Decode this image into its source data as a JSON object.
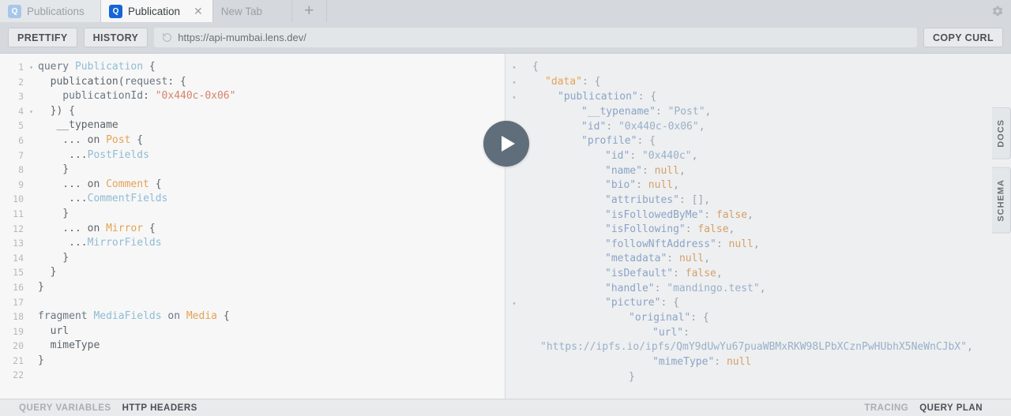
{
  "tabs": [
    {
      "badge": "Q",
      "label": "Publications",
      "active": false,
      "closable": false
    },
    {
      "badge": "Q",
      "label": "Publication",
      "active": true,
      "closable": true
    },
    {
      "badge": "",
      "label": "New Tab",
      "active": false,
      "closable": false
    }
  ],
  "tab_add_label": "+",
  "gear_icon": "gear-icon",
  "toolbar": {
    "prettify_label": "PRETTIFY",
    "history_label": "HISTORY",
    "url_value": "https://api-mumbai.lens.dev/",
    "url_icon": "history-revert-icon",
    "copy_curl_label": "COPY CURL"
  },
  "editor": {
    "lines": [
      {
        "n": "1",
        "fold": "▾",
        "tokens": [
          {
            "t": "query ",
            "c": "t-kw"
          },
          {
            "t": "Publication",
            "c": "t-def"
          },
          {
            "t": " {",
            "c": "t-pln"
          }
        ],
        "indent": 0
      },
      {
        "n": "2",
        "fold": "",
        "tokens": [
          {
            "t": "  publication(",
            "c": "t-pln"
          },
          {
            "t": "request",
            "c": "t-arg"
          },
          {
            "t": ": {",
            "c": "t-pln"
          }
        ],
        "indent": 0
      },
      {
        "n": "3",
        "fold": "",
        "tokens": [
          {
            "t": "    publicationId",
            "c": "t-arg"
          },
          {
            "t": ": ",
            "c": "t-pln"
          },
          {
            "t": "\"0x440c-0x06\"",
            "c": "t-str"
          }
        ],
        "indent": 0
      },
      {
        "n": "4",
        "fold": "▾",
        "tokens": [
          {
            "t": "  }) {",
            "c": "t-pln"
          }
        ],
        "indent": 0
      },
      {
        "n": "5",
        "fold": "",
        "tokens": [
          {
            "t": "   __typename",
            "c": "t-pln"
          }
        ],
        "indent": 0
      },
      {
        "n": "6",
        "fold": "",
        "tokens": [
          {
            "t": "    ... on ",
            "c": "t-pln"
          },
          {
            "t": "Post",
            "c": "t-type"
          },
          {
            "t": " {",
            "c": "t-pln"
          }
        ],
        "indent": 0
      },
      {
        "n": "7",
        "fold": "",
        "tokens": [
          {
            "t": "     ...",
            "c": "t-pln"
          },
          {
            "t": "PostFields",
            "c": "t-frag"
          }
        ],
        "indent": 0
      },
      {
        "n": "8",
        "fold": "",
        "tokens": [
          {
            "t": "    }",
            "c": "t-pln"
          }
        ],
        "indent": 0
      },
      {
        "n": "9",
        "fold": "",
        "tokens": [
          {
            "t": "    ... on ",
            "c": "t-pln"
          },
          {
            "t": "Comment",
            "c": "t-type"
          },
          {
            "t": " {",
            "c": "t-pln"
          }
        ],
        "indent": 0
      },
      {
        "n": "10",
        "fold": "",
        "tokens": [
          {
            "t": "     ...",
            "c": "t-pln"
          },
          {
            "t": "CommentFields",
            "c": "t-frag"
          }
        ],
        "indent": 0
      },
      {
        "n": "11",
        "fold": "",
        "tokens": [
          {
            "t": "    }",
            "c": "t-pln"
          }
        ],
        "indent": 0
      },
      {
        "n": "12",
        "fold": "",
        "tokens": [
          {
            "t": "    ... on ",
            "c": "t-pln"
          },
          {
            "t": "Mirror",
            "c": "t-type"
          },
          {
            "t": " {",
            "c": "t-pln"
          }
        ],
        "indent": 0
      },
      {
        "n": "13",
        "fold": "",
        "tokens": [
          {
            "t": "     ...",
            "c": "t-pln"
          },
          {
            "t": "MirrorFields",
            "c": "t-frag"
          }
        ],
        "indent": 0
      },
      {
        "n": "14",
        "fold": "",
        "tokens": [
          {
            "t": "    }",
            "c": "t-pln"
          }
        ],
        "indent": 0
      },
      {
        "n": "15",
        "fold": "",
        "tokens": [
          {
            "t": "  }",
            "c": "t-pln"
          }
        ],
        "indent": 0
      },
      {
        "n": "16",
        "fold": "",
        "tokens": [
          {
            "t": "}",
            "c": "t-pln"
          }
        ],
        "indent": 0
      },
      {
        "n": "17",
        "fold": "",
        "tokens": [],
        "indent": 0
      },
      {
        "n": "18",
        "fold": "",
        "tokens": [
          {
            "t": "fragment ",
            "c": "t-kw"
          },
          {
            "t": "MediaFields",
            "c": "t-frag"
          },
          {
            "t": " on ",
            "c": "t-kw"
          },
          {
            "t": "Media",
            "c": "t-type"
          },
          {
            "t": " {",
            "c": "t-pln"
          }
        ],
        "indent": 0
      },
      {
        "n": "19",
        "fold": "",
        "tokens": [
          {
            "t": "  url",
            "c": "t-pln"
          }
        ],
        "indent": 0
      },
      {
        "n": "20",
        "fold": "",
        "tokens": [
          {
            "t": "  mimeType",
            "c": "t-pln"
          }
        ],
        "indent": 0
      },
      {
        "n": "21",
        "fold": "",
        "tokens": [
          {
            "t": "}",
            "c": "t-pln"
          }
        ],
        "indent": 0
      },
      {
        "n": "22",
        "fold": "",
        "tokens": [],
        "indent": 0
      }
    ]
  },
  "result": {
    "lines": [
      {
        "fold": "▾",
        "tokens": [
          {
            "t": "{",
            "c": "j-pun"
          }
        ],
        "pad": 12
      },
      {
        "fold": "▾",
        "tokens": [
          {
            "t": "\"data\"",
            "c": "j-key-top"
          },
          {
            "t": ": {",
            "c": "j-pun"
          }
        ],
        "pad": 28
      },
      {
        "fold": "▾",
        "tokens": [
          {
            "t": "\"publication\"",
            "c": "j-key"
          },
          {
            "t": ": {",
            "c": "j-pun"
          }
        ],
        "pad": 44
      },
      {
        "fold": "",
        "tokens": [
          {
            "t": "\"__typename\"",
            "c": "j-key"
          },
          {
            "t": ": ",
            "c": "j-pun"
          },
          {
            "t": "\"Post\"",
            "c": "j-str"
          },
          {
            "t": ",",
            "c": "j-pun"
          }
        ],
        "pad": 74
      },
      {
        "fold": "",
        "tokens": [
          {
            "t": "\"id\"",
            "c": "j-key"
          },
          {
            "t": ": ",
            "c": "j-pun"
          },
          {
            "t": "\"0x440c-0x06\"",
            "c": "j-str"
          },
          {
            "t": ",",
            "c": "j-pun"
          }
        ],
        "pad": 74
      },
      {
        "fold": "▾",
        "tokens": [
          {
            "t": "\"profile\"",
            "c": "j-key"
          },
          {
            "t": ": {",
            "c": "j-pun"
          }
        ],
        "pad": 74
      },
      {
        "fold": "",
        "tokens": [
          {
            "t": "\"id\"",
            "c": "j-key"
          },
          {
            "t": ": ",
            "c": "j-pun"
          },
          {
            "t": "\"0x440c\"",
            "c": "j-str"
          },
          {
            "t": ",",
            "c": "j-pun"
          }
        ],
        "pad": 104
      },
      {
        "fold": "",
        "tokens": [
          {
            "t": "\"name\"",
            "c": "j-key"
          },
          {
            "t": ": ",
            "c": "j-pun"
          },
          {
            "t": "null",
            "c": "j-lit"
          },
          {
            "t": ",",
            "c": "j-pun"
          }
        ],
        "pad": 104
      },
      {
        "fold": "",
        "tokens": [
          {
            "t": "\"bio\"",
            "c": "j-key"
          },
          {
            "t": ": ",
            "c": "j-pun"
          },
          {
            "t": "null",
            "c": "j-lit"
          },
          {
            "t": ",",
            "c": "j-pun"
          }
        ],
        "pad": 104
      },
      {
        "fold": "",
        "tokens": [
          {
            "t": "\"attributes\"",
            "c": "j-key"
          },
          {
            "t": ": [],",
            "c": "j-pun"
          }
        ],
        "pad": 104
      },
      {
        "fold": "",
        "tokens": [
          {
            "t": "\"isFollowedByMe\"",
            "c": "j-key"
          },
          {
            "t": ": ",
            "c": "j-pun"
          },
          {
            "t": "false",
            "c": "j-lit"
          },
          {
            "t": ",",
            "c": "j-pun"
          }
        ],
        "pad": 104
      },
      {
        "fold": "",
        "tokens": [
          {
            "t": "\"isFollowing\"",
            "c": "j-key"
          },
          {
            "t": ": ",
            "c": "j-pun"
          },
          {
            "t": "false",
            "c": "j-lit"
          },
          {
            "t": ",",
            "c": "j-pun"
          }
        ],
        "pad": 104
      },
      {
        "fold": "",
        "tokens": [
          {
            "t": "\"followNftAddress\"",
            "c": "j-key"
          },
          {
            "t": ": ",
            "c": "j-pun"
          },
          {
            "t": "null",
            "c": "j-lit"
          },
          {
            "t": ",",
            "c": "j-pun"
          }
        ],
        "pad": 104
      },
      {
        "fold": "",
        "tokens": [
          {
            "t": "\"metadata\"",
            "c": "j-key"
          },
          {
            "t": ": ",
            "c": "j-pun"
          },
          {
            "t": "null",
            "c": "j-lit"
          },
          {
            "t": ",",
            "c": "j-pun"
          }
        ],
        "pad": 104
      },
      {
        "fold": "",
        "tokens": [
          {
            "t": "\"isDefault\"",
            "c": "j-key"
          },
          {
            "t": ": ",
            "c": "j-pun"
          },
          {
            "t": "false",
            "c": "j-lit"
          },
          {
            "t": ",",
            "c": "j-pun"
          }
        ],
        "pad": 104
      },
      {
        "fold": "",
        "tokens": [
          {
            "t": "\"handle\"",
            "c": "j-key"
          },
          {
            "t": ": ",
            "c": "j-pun"
          },
          {
            "t": "\"mandingo.test\"",
            "c": "j-str"
          },
          {
            "t": ",",
            "c": "j-pun"
          }
        ],
        "pad": 104
      },
      {
        "fold": "▾",
        "tokens": [
          {
            "t": "\"picture\"",
            "c": "j-key"
          },
          {
            "t": ": {",
            "c": "j-pun"
          }
        ],
        "pad": 104
      },
      {
        "fold": "",
        "tokens": [
          {
            "t": "\"original\"",
            "c": "j-key"
          },
          {
            "t": ": {",
            "c": "j-pun"
          }
        ],
        "pad": 134
      },
      {
        "fold": "",
        "tokens": [
          {
            "t": "\"url\"",
            "c": "j-key"
          },
          {
            "t": ":",
            "c": "j-pun"
          }
        ],
        "pad": 164
      },
      {
        "fold": "",
        "tokens": [
          {
            "t": "\"https://ipfs.io/ipfs/QmY9dUwYu67puaWBMxRKW98LPbXCznPwHUbhX5NeWnCJbX\"",
            "c": "j-str"
          },
          {
            "t": ",",
            "c": "j-pun"
          }
        ],
        "pad": 22
      },
      {
        "fold": "",
        "tokens": [
          {
            "t": "\"mimeType\"",
            "c": "j-key"
          },
          {
            "t": ": ",
            "c": "j-pun"
          },
          {
            "t": "null",
            "c": "j-lit"
          }
        ],
        "pad": 164
      },
      {
        "fold": "",
        "tokens": [
          {
            "t": "}",
            "c": "j-pun"
          },
          {
            "t": "",
            "c": "j-pun"
          }
        ],
        "pad": 134
      }
    ]
  },
  "side_tabs": [
    {
      "label": "DOCS"
    },
    {
      "label": "SCHEMA"
    }
  ],
  "bottom_bar": {
    "left": [
      {
        "label": "QUERY VARIABLES",
        "active": false
      },
      {
        "label": "HTTP HEADERS",
        "active": true
      }
    ],
    "right": [
      {
        "label": "TRACING",
        "active": false
      },
      {
        "label": "QUERY PLAN",
        "active": true
      }
    ]
  },
  "execute_button": {
    "name": "execute-query-button"
  }
}
